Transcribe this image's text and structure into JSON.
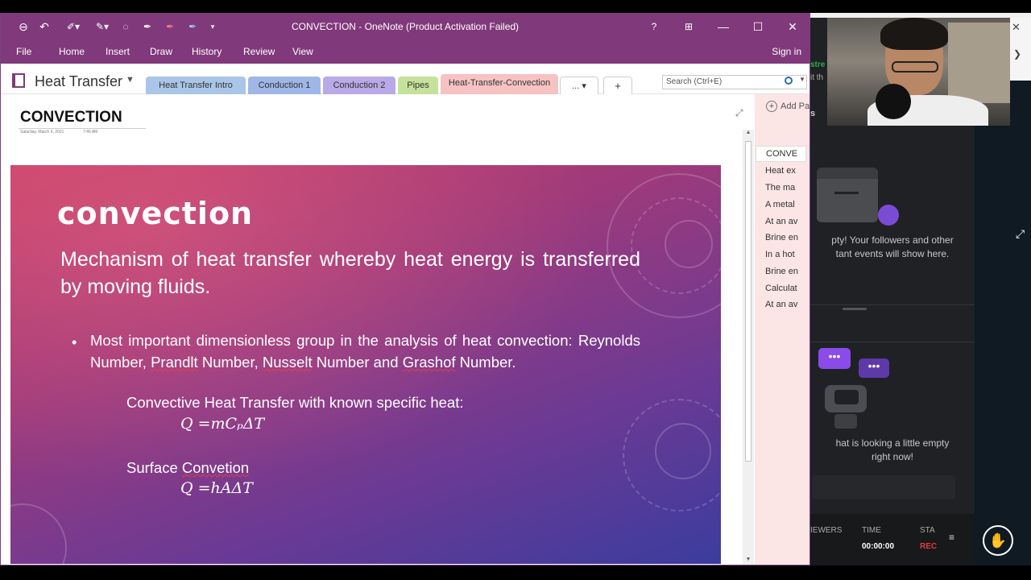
{
  "onenote": {
    "window_title": "CONVECTION - OneNote (Product Activation Failed)",
    "title_buttons": {
      "help": "?",
      "restore_mode": "⊞",
      "minimize": "—",
      "maximize": "☐",
      "close": "✕"
    },
    "ribbon_tabs": [
      "File",
      "Home",
      "Insert",
      "Draw",
      "History",
      "Review",
      "View"
    ],
    "sign_in": "Sign in",
    "notebook": "Heat Transfer",
    "section_tabs": [
      {
        "label": "Heat Transfer Intro",
        "color": "#a9c6e8"
      },
      {
        "label": "Conduction 1",
        "color": "#9fb7e6"
      },
      {
        "label": "Conduction 2",
        "color": "#b9a9e6"
      },
      {
        "label": "Pipes",
        "color": "#c6e29a"
      },
      {
        "label": "Heat-Transfer-Convection",
        "color": "#f6c2c2"
      }
    ],
    "more_tabs": "... ▾",
    "add_tab": "+",
    "search_placeholder": "Search (Ctrl+E)",
    "page": {
      "title": "CONVECTION",
      "date": "Saturday, March 6, 2021",
      "time": "7:46 AM"
    },
    "add_page": "Add Pa",
    "pages": [
      "CONVE",
      "Heat ex",
      "The ma",
      "A metal",
      "At an av",
      "Brine en",
      "In a hot",
      "Brine en",
      "Calculat",
      "At an av"
    ]
  },
  "slide": {
    "heading": "convection",
    "definition": "Mechanism of heat transfer whereby heat energy is transferred by moving fluids.",
    "bullet_parts": {
      "intro": "Most important dimensionless group in the analysis of heat convection: Reynolds Number, ",
      "prandlt": "Prandlt",
      "mid1": " Number, ",
      "nusselt": "Nusselt",
      "mid2": " Number and ",
      "grashof": "Grashof",
      "end": " Number."
    },
    "label_cp": "Convective Heat Transfer with known specific heat:",
    "eq_cp": "Q =mCₚΔT",
    "label_surface_prefix": "Surface ",
    "label_surface_word": "Convetion",
    "eq_surface": "Q =hAΔT"
  },
  "stream": {
    "partial_name": "stre",
    "partial_sub": "it th",
    "partial_s": "s",
    "empty_events": "pty! Your followers and other\ntant events will show here.",
    "empty_chat": "hat is looking a little empty\nright now!",
    "stats": {
      "viewers_label": "IEWERS",
      "time_label": "TIME",
      "time_value": "00:00:00",
      "status_label": "STA",
      "status_value": "REC"
    }
  }
}
